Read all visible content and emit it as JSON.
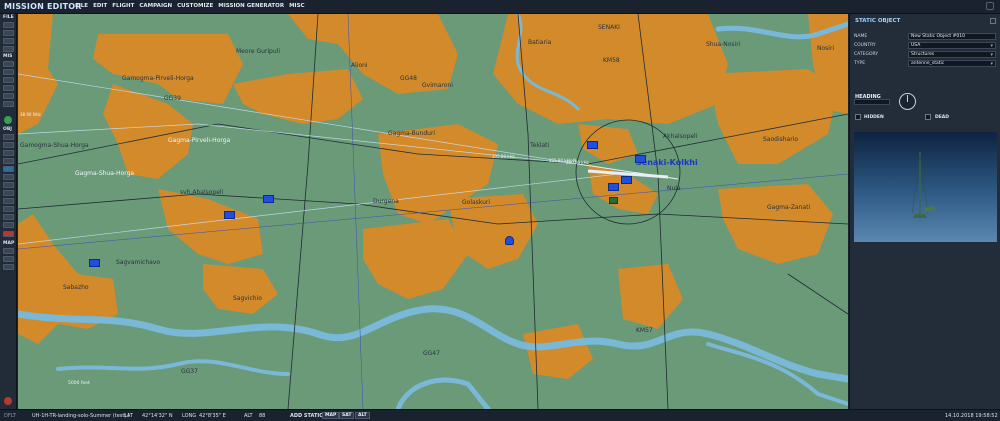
{
  "app": {
    "title": "MISSION EDITOR",
    "menu": [
      "FILE",
      "EDIT",
      "FLIGHT",
      "CAMPAIGN",
      "CUSTOMIZE",
      "MISSION GENERATOR",
      "MISC"
    ]
  },
  "toolbar": {
    "sections": [
      {
        "key": "file",
        "label": "FILE"
      },
      {
        "key": "mis",
        "label": "MIS"
      },
      {
        "key": "obj",
        "label": "OBJ"
      },
      {
        "key": "map",
        "label": "MAP"
      }
    ]
  },
  "map": {
    "labels": [
      {
        "text": "Meore Guripuli",
        "style": "normal"
      },
      {
        "text": "Gamogma-Pirveli-Horga",
        "style": "normal"
      },
      {
        "text": "GG39",
        "style": "normal"
      },
      {
        "text": "Alioni",
        "style": "normal"
      },
      {
        "text": "GG48",
        "style": "normal"
      },
      {
        "text": "Gvimaroni",
        "style": "normal"
      },
      {
        "text": "Batiaria",
        "style": "normal"
      },
      {
        "text": "SENAKI",
        "style": "normal"
      },
      {
        "text": "KM58",
        "style": "normal"
      },
      {
        "text": "Shua-Nosiri",
        "style": "normal"
      },
      {
        "text": "Nosiri",
        "style": "normal"
      },
      {
        "text": "Gamogma-Shua-Horga",
        "style": "normal"
      },
      {
        "text": "Gagma-Pirveli-Horga",
        "style": "white"
      },
      {
        "text": "Gagma-Shua-Horga",
        "style": "white"
      },
      {
        "text": "Gagma-Bunduri",
        "style": "normal"
      },
      {
        "text": "Teklati",
        "style": "normal"
      },
      {
        "text": "Akhalsopeli",
        "style": "normal"
      },
      {
        "text": "Saodishario",
        "style": "normal"
      },
      {
        "text": "Senaki-Kolkhi",
        "style": "city"
      },
      {
        "text": "Nula",
        "style": "normal"
      },
      {
        "text": "svh.Ahalsopeli",
        "style": "normal"
      },
      {
        "text": "Durgena",
        "style": "normal"
      },
      {
        "text": "Golaskuri",
        "style": "normal"
      },
      {
        "text": "Gagma-Zanati",
        "style": "normal"
      },
      {
        "text": "Sagvamichavo",
        "style": "normal"
      },
      {
        "text": "Sabazho",
        "style": "normal"
      },
      {
        "text": "Sagvichio",
        "style": "normal"
      },
      {
        "text": "KM57",
        "style": "normal"
      },
      {
        "text": "GG47",
        "style": "normal"
      },
      {
        "text": "GG37",
        "style": "normal"
      },
      {
        "text": "5000 feet",
        "style": "white"
      },
      {
        "text": "38.90 NHz",
        "style": "small"
      },
      {
        "text": "335.80 kHz",
        "style": "small"
      },
      {
        "text": "560.00 kHz",
        "style": "small"
      },
      {
        "text": "335.80 kHz N",
        "style": "small"
      }
    ]
  },
  "panel": {
    "title": "STATIC OBJECT",
    "fields": [
      {
        "label": "NAME",
        "value": "New Static Object #010",
        "dropdown": false
      },
      {
        "label": "COUNTRY",
        "value": "USA",
        "dropdown": true
      },
      {
        "label": "CATEGORY",
        "value": "Structures",
        "dropdown": true
      },
      {
        "label": "TYPE",
        "value": "antenne_static",
        "dropdown": true
      }
    ],
    "heading_label": "HEADING",
    "hidden_label": "HIDDEN",
    "dead_label": "DEAD"
  },
  "status": {
    "coord_label": "DFLT",
    "mission_file": "UH-1H-TR-landing-solo-Summer (test).i",
    "lat_label": "LAT",
    "lat_value": "42°14'32\" N",
    "long_label": "LONG",
    "long_value": "42°8'35\" E",
    "alt_label": "ALT",
    "alt_value": "88",
    "add_static": "ADD STATIC",
    "btn_map": "MAP",
    "btn_sat": "SAT",
    "btn_alt": "ALT",
    "datetime": "14.10.2018 19:58:52"
  },
  "colors": {
    "grass": "#6a9a78",
    "urban": "#d28a2b",
    "water": "#7ab8d8",
    "unit": "#1f4fe0",
    "accent": "#9fd2ff"
  }
}
